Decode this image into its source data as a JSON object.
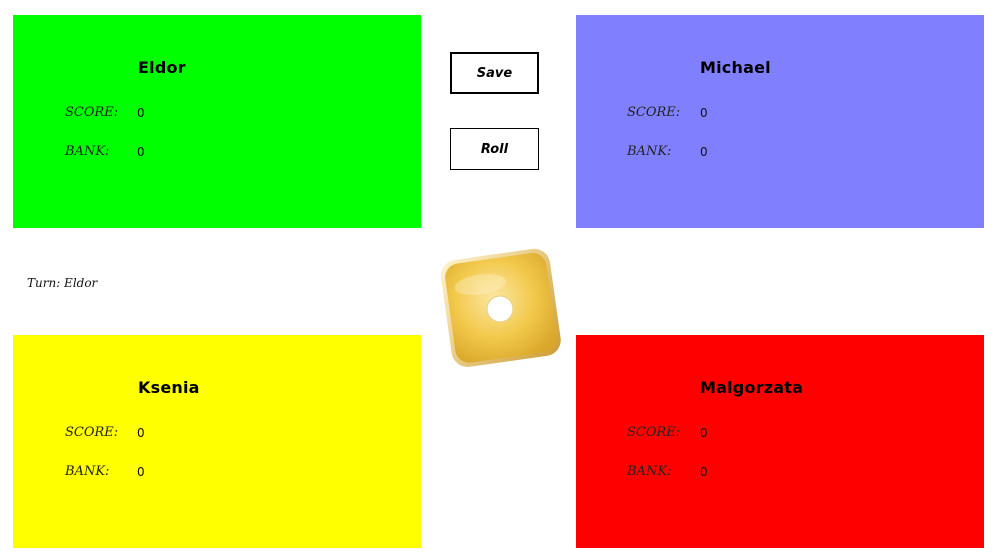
{
  "players": [
    {
      "id": "tl",
      "name": "Eldor",
      "score_label": "SCORE:",
      "score": "0",
      "bank_label": "BANK:",
      "bank": "0",
      "color": "#00ff00"
    },
    {
      "id": "tr",
      "name": "Michael",
      "score_label": "SCORE:",
      "score": "0",
      "bank_label": "BANK:",
      "bank": "0",
      "color": "#8080ff"
    },
    {
      "id": "bl",
      "name": "Ksenia",
      "score_label": "SCORE:",
      "score": "0",
      "bank_label": "BANK:",
      "bank": "0",
      "color": "#ffff00"
    },
    {
      "id": "br",
      "name": "Malgorzata",
      "score_label": "SCORE:",
      "score": "0",
      "bank_label": "BANK:",
      "bank": "0",
      "color": "#ff0000"
    }
  ],
  "controls": {
    "save_label": "Save",
    "roll_label": "Roll"
  },
  "turn": {
    "text": "Turn: Eldor"
  },
  "die": {
    "value": 1,
    "color": "#f2c94c"
  }
}
